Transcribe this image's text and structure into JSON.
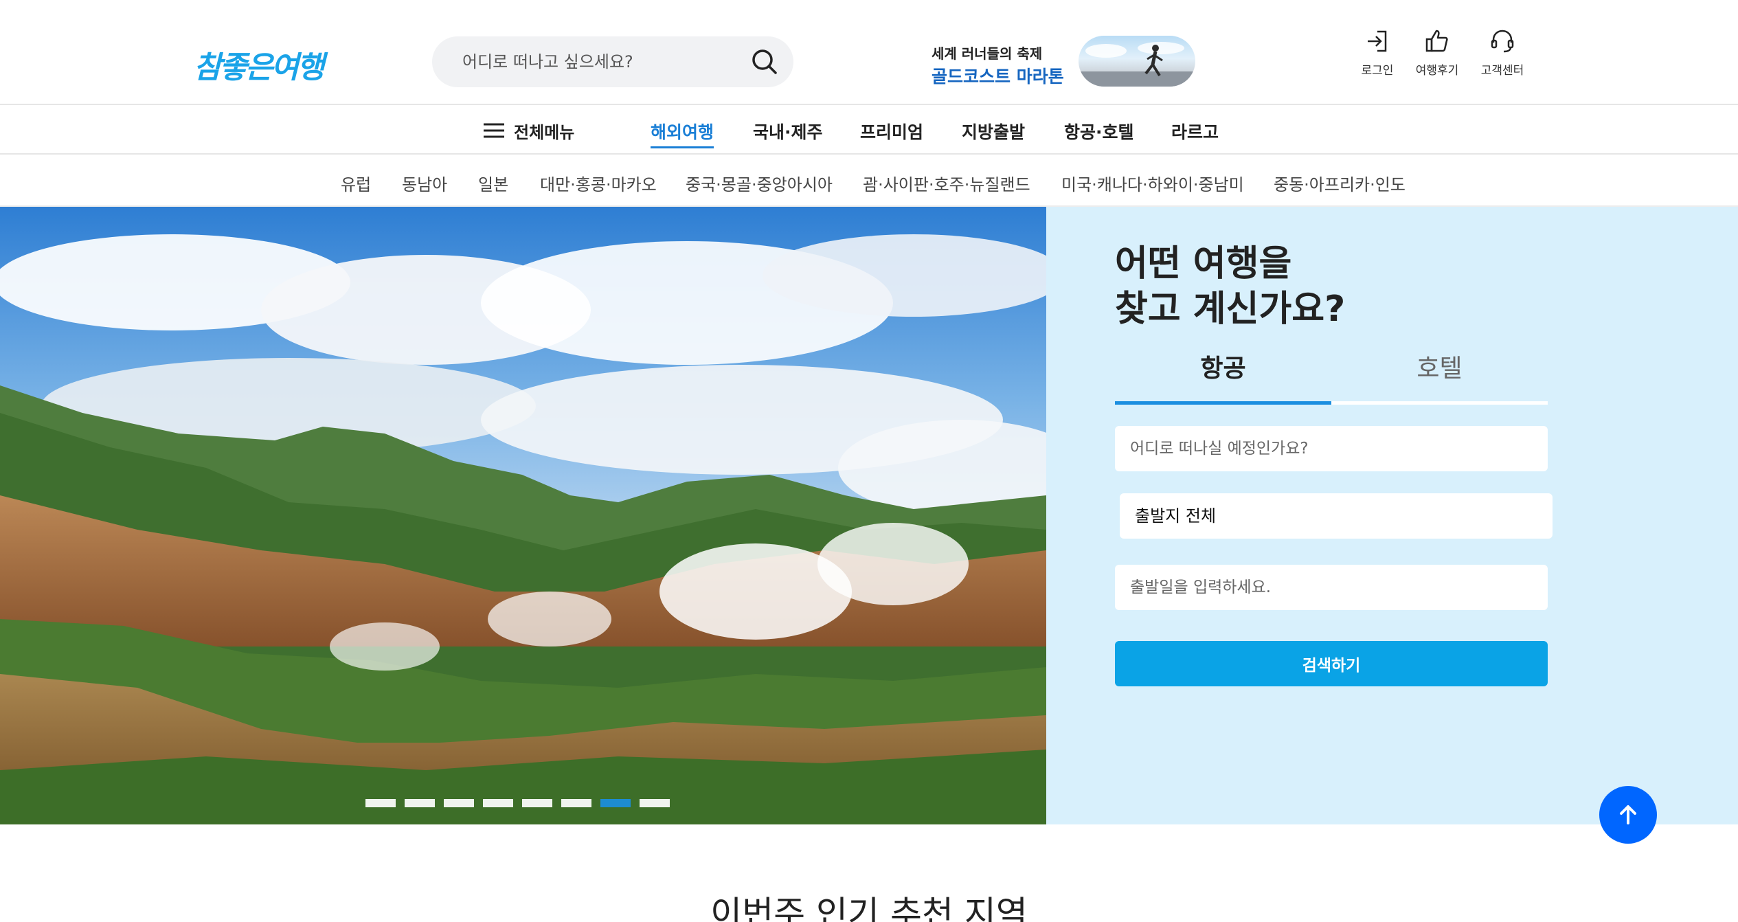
{
  "header": {
    "logo": "참좋은여행",
    "search_placeholder": "어디로 떠나고 싶으세요?",
    "banner_line1": "세계 러너들의 축제",
    "banner_line2": "골드코스트 마라톤",
    "utils": [
      {
        "label": "로그인",
        "icon": "login-icon"
      },
      {
        "label": "여행후기",
        "icon": "thumbs-up-icon"
      },
      {
        "label": "고객센터",
        "icon": "headset-icon"
      }
    ]
  },
  "nav": {
    "all_menu": "전체메뉴",
    "items": [
      "해외여행",
      "국내·제주",
      "프리미엄",
      "지방출발",
      "항공·호텔",
      "라르고"
    ],
    "active": "해외여행"
  },
  "subnav": {
    "items": [
      "유럽",
      "동남아",
      "일본",
      "대만·홍콩·마카오",
      "중국·몽골·중앙아시아",
      "괌·사이판·호주·뉴질랜드",
      "미국·캐나다·하와이·중남미",
      "중동·아프리카·인도"
    ]
  },
  "hero": {
    "slide_count": 8,
    "active_slide": 7
  },
  "panel": {
    "title": "어떤 여행을\n찾고 계신가요?",
    "tabs": [
      "항공",
      "호텔"
    ],
    "active_tab": "항공",
    "destination_placeholder": "어디로 떠나실 예정인가요?",
    "departure_select": "출발지 전체",
    "date_placeholder": "출발일을 입력하세요.",
    "submit_label": "검색하기"
  },
  "section": {
    "title": "이번주 인기 추천 지역"
  },
  "colors": {
    "brand": "#1aa3e8",
    "accent": "#1a7fd6",
    "panel_bg": "#d8f0fc",
    "submit": "#0aa3e6",
    "top_button": "#0066ff"
  }
}
